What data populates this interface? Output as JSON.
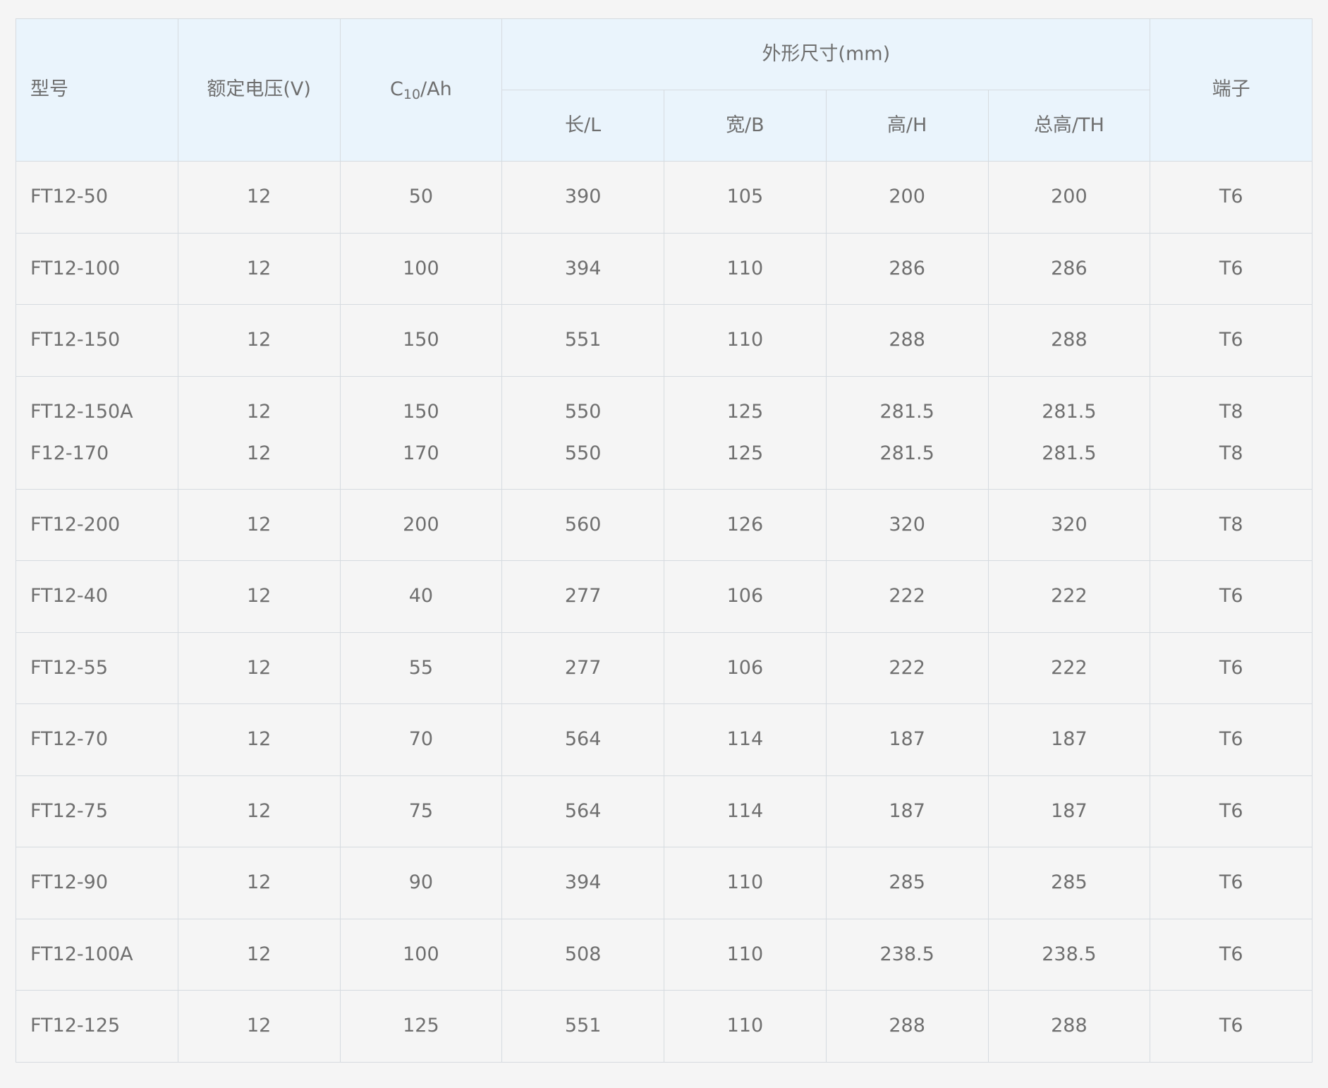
{
  "header": {
    "model": "型号",
    "voltage": "额定电压(V)",
    "capacity_main": "C",
    "capacity_sub": "10",
    "capacity_unit": "/Ah",
    "dimensions": "外形尺寸(mm)",
    "length": "长/L",
    "width": "宽/B",
    "height": "高/H",
    "total_height": "总高/TH",
    "terminal": "端子"
  },
  "rows": [
    {
      "model": "FT12-50",
      "voltage": "12",
      "capacity": "50",
      "length": "390",
      "width": "105",
      "height": "200",
      "total_height": "200",
      "terminal": "T6"
    },
    {
      "model": "FT12-100",
      "voltage": "12",
      "capacity": "100",
      "length": "394",
      "width": "110",
      "height": "286",
      "total_height": "286",
      "terminal": "T6"
    },
    {
      "model": "FT12-150",
      "voltage": "12",
      "capacity": "150",
      "length": "551",
      "width": "110",
      "height": "288",
      "total_height": "288",
      "terminal": "T6"
    },
    {
      "model": "FT12-150A",
      "voltage": "12",
      "capacity": "150",
      "length": "550",
      "width": "125",
      "height": "281.5",
      "total_height": "281.5",
      "terminal": "T8"
    },
    {
      "model": "F12-170",
      "voltage": "12",
      "capacity": "170",
      "length": "550",
      "width": "125",
      "height": "281.5",
      "total_height": "281.5",
      "terminal": "T8"
    },
    {
      "model": "FT12-200",
      "voltage": "12",
      "capacity": "200",
      "length": "560",
      "width": "126",
      "height": "320",
      "total_height": "320",
      "terminal": "T8"
    },
    {
      "model": "FT12-40",
      "voltage": "12",
      "capacity": "40",
      "length": "277",
      "width": "106",
      "height": "222",
      "total_height": "222",
      "terminal": "T6"
    },
    {
      "model": "FT12-55",
      "voltage": "12",
      "capacity": "55",
      "length": "277",
      "width": "106",
      "height": "222",
      "total_height": "222",
      "terminal": "T6"
    },
    {
      "model": "FT12-70",
      "voltage": "12",
      "capacity": "70",
      "length": "564",
      "width": "114",
      "height": "187",
      "total_height": "187",
      "terminal": "T6"
    },
    {
      "model": "FT12-75",
      "voltage": "12",
      "capacity": "75",
      "length": "564",
      "width": "114",
      "height": "187",
      "total_height": "187",
      "terminal": "T6"
    },
    {
      "model": "FT12-90",
      "voltage": "12",
      "capacity": "90",
      "length": "394",
      "width": "110",
      "height": "285",
      "total_height": "285",
      "terminal": "T6"
    },
    {
      "model": "FT12-100A",
      "voltage": "12",
      "capacity": "100",
      "length": "508",
      "width": "110",
      "height": "238.5",
      "total_height": "238.5",
      "terminal": "T6"
    },
    {
      "model": "FT12-125",
      "voltage": "12",
      "capacity": "125",
      "length": "551",
      "width": "110",
      "height": "288",
      "total_height": "288",
      "terminal": "T6"
    }
  ],
  "colors": {
    "page_background": "#f5f5f5",
    "header_background": "#eaf4fc",
    "border": "#d6dbe0",
    "text": "#6f6f6f"
  }
}
